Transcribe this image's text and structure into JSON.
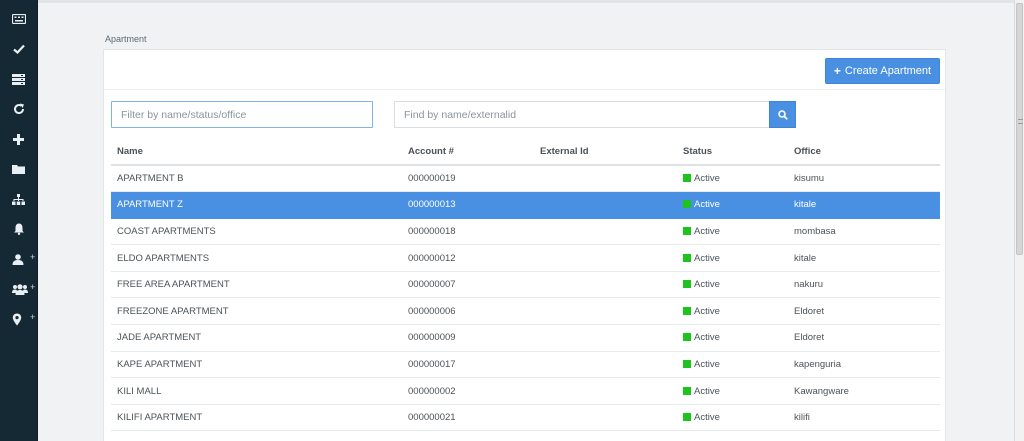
{
  "sidebar": {
    "items": [
      {
        "icon": "keyboard-icon"
      },
      {
        "icon": "checkmark-icon"
      },
      {
        "icon": "server-icon"
      },
      {
        "icon": "refresh-icon"
      },
      {
        "icon": "plus-icon"
      },
      {
        "icon": "folder-icon"
      },
      {
        "icon": "sitemap-icon"
      },
      {
        "icon": "bell-icon"
      },
      {
        "icon": "user-icon",
        "suffix": "+"
      },
      {
        "icon": "users-icon",
        "suffix": "+"
      },
      {
        "icon": "map-marker-icon",
        "suffix": "+"
      }
    ]
  },
  "breadcrumb": "Apartment",
  "toolbar": {
    "create_label": "Create Apartment",
    "create_icon": "+"
  },
  "filters": {
    "filter_placeholder": "Filter by name/status/office",
    "find_placeholder": "Find by name/externalid"
  },
  "table": {
    "headers": [
      "Name",
      "Account #",
      "External Id",
      "Status",
      "Office"
    ],
    "rows": [
      {
        "name": "APARTMENT B",
        "account": "000000019",
        "external_id": "",
        "status": "Active",
        "office": "kisumu"
      },
      {
        "name": "APARTMENT Z",
        "account": "000000013",
        "external_id": "",
        "status": "Active",
        "office": "kitale"
      },
      {
        "name": "COAST APARTMENTS",
        "account": "000000018",
        "external_id": "",
        "status": "Active",
        "office": "mombasa"
      },
      {
        "name": "ELDO APARTMENTS",
        "account": "000000012",
        "external_id": "",
        "status": "Active",
        "office": "kitale"
      },
      {
        "name": "FREE AREA APARTMENT",
        "account": "000000007",
        "external_id": "",
        "status": "Active",
        "office": "nakuru"
      },
      {
        "name": "FREEZONE APARTMENT",
        "account": "000000006",
        "external_id": "",
        "status": "Active",
        "office": "Eldoret"
      },
      {
        "name": "JADE APARTMENT",
        "account": "000000009",
        "external_id": "",
        "status": "Active",
        "office": "Eldoret"
      },
      {
        "name": "KAPE APARTMENT",
        "account": "000000017",
        "external_id": "",
        "status": "Active",
        "office": "kapenguria"
      },
      {
        "name": "KILI MALL",
        "account": "000000002",
        "external_id": "",
        "status": "Active",
        "office": "Kawangware"
      },
      {
        "name": "KILIFI APARTMENT",
        "account": "000000021",
        "external_id": "",
        "status": "Active",
        "office": "kilifi"
      }
    ],
    "selected_index": 1
  },
  "colors": {
    "sidebar_bg": "#152935",
    "accent": "#4a90e2",
    "status_active": "#1ec41e"
  }
}
